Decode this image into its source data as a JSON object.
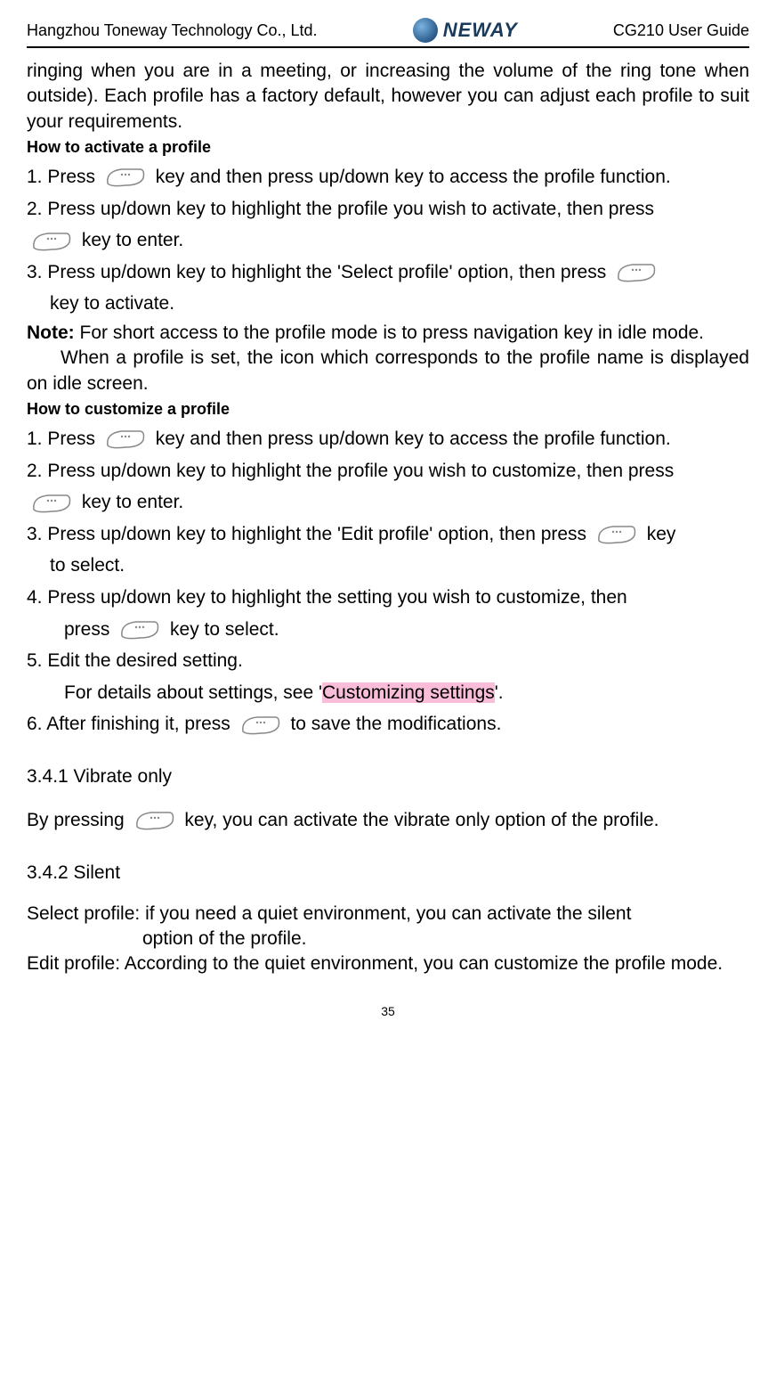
{
  "header": {
    "company": "Hangzhou Toneway Technology Co., Ltd.",
    "logo_text": "NEWAY",
    "guide": "CG210 User Guide"
  },
  "intro": "ringing when you are in a meeting, or increasing the volume of the ring tone when outside). Each profile has a factory default, however you can adjust each profile to suit your requirements.",
  "activate_heading": "How to activate a profile",
  "activate": {
    "step1_a": "1. Press ",
    "step1_b": " key and then press up/down key to access the profile function.",
    "step2_a": "2. Press up/down key to highlight the profile you wish to activate, then press ",
    "step2_b": " key to enter.",
    "step3_a": "3. Press up/down key to highlight the 'Select profile' option, then press ",
    "step3_b": "key to activate."
  },
  "note_label": "Note: ",
  "note_text": "For short access to the profile mode is to press navigation key in idle mode.",
  "note_para2": "When a profile is set, the icon which corresponds to the profile name is displayed on idle screen.",
  "customize_heading": "How to customize a profile",
  "customize": {
    "step1_a": "1. Press ",
    "step1_b": " key and then press up/down key to access the profile function.",
    "step2_a": "2. Press up/down key to highlight the profile you wish to customize, then press ",
    "step2_b": " key to enter.",
    "step3_a": "3. Press up/down key to highlight the 'Edit profile' option, then press ",
    "step3_b": " key ",
    "step3_c": "to select.",
    "step4_a": "4. Press up/down key to highlight the setting you wish to customize, then ",
    "step4_b": "press ",
    "step4_c": " key to select.",
    "step5_a": "5.  Edit the desired setting.",
    "step5_b_pre": "For details about settings, see '",
    "step5_b_hl": "Customizing settings",
    "step5_b_post": "'.",
    "step6_a": "6.   After finishing it, press ",
    "step6_b": " to save the modifications."
  },
  "section_341": "3.4.1 Vibrate only",
  "vibrate_a": "By pressing ",
  "vibrate_b": " key, you can activate the vibrate only option of the profile.",
  "section_342": "3.4.2 Silent",
  "silent_select_a": "Select profile: if you need a quiet environment, you can activate the silent ",
  "silent_select_b": "option of the profile.",
  "silent_edit": "Edit profile: According to the quiet environment, you can customize the profile mode.",
  "page_no": "35"
}
